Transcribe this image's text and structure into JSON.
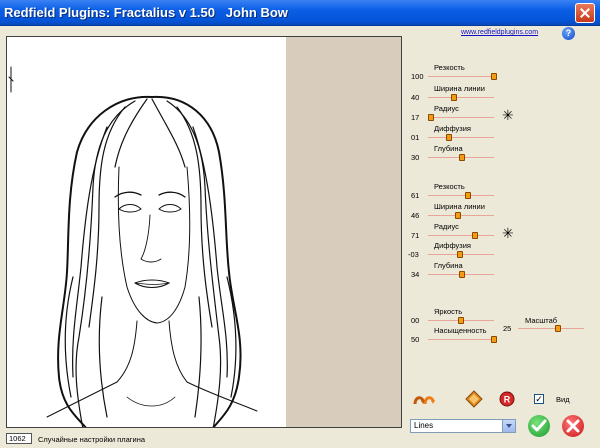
{
  "window": {
    "title": "Redfield Plugins: Fractalius v 1.50   John Bow"
  },
  "header": {
    "link_text": "www.redfieldplugins.com",
    "help_label": "?"
  },
  "group1": {
    "controls": [
      {
        "label": "Резкость",
        "value": "100",
        "level": 1.0
      },
      {
        "label": "Ширина линии",
        "value": "40",
        "level": 0.4
      },
      {
        "label": "Радиус",
        "value": "17",
        "level": 0.05
      },
      {
        "label": "Диффузия",
        "value": "01",
        "level": 0.32
      },
      {
        "label": "Глубина",
        "value": "30",
        "level": 0.52
      }
    ]
  },
  "group2": {
    "controls": [
      {
        "label": "Резкость",
        "value": "61",
        "level": 0.61
      },
      {
        "label": "Ширина линии",
        "value": "46",
        "level": 0.46
      },
      {
        "label": "Радиус",
        "value": "71",
        "level": 0.71
      },
      {
        "label": "Диффузия",
        "value": "-03",
        "level": 0.49
      },
      {
        "label": "Глубина",
        "value": "34",
        "level": 0.52
      }
    ]
  },
  "group3": {
    "controls": [
      {
        "label": "Яркость",
        "value": "00",
        "level": 0.5
      },
      {
        "label": "Насыщенность",
        "value": "50",
        "level": 1.0
      }
    ],
    "scale": {
      "label": "Масштаб",
      "value": "25",
      "level": 0.6
    }
  },
  "bottom": {
    "counter": "1062",
    "status": "Случайные настройки плагина",
    "mode_selected": "Lines",
    "view_label": "Вид",
    "view_checked": true
  },
  "icons": {
    "random": "random-icon",
    "diamond": "diamond-icon",
    "reset": "reset-icon",
    "ok": "ok-icon",
    "cancel": "cancel-icon",
    "radius_star": "star-icon"
  },
  "colors": {
    "title_bar": "#0553d6",
    "slider_track": "#b8281d",
    "slider_thumb": "#f59c14",
    "ok": "#1a9a2b",
    "cancel": "#c81616"
  }
}
